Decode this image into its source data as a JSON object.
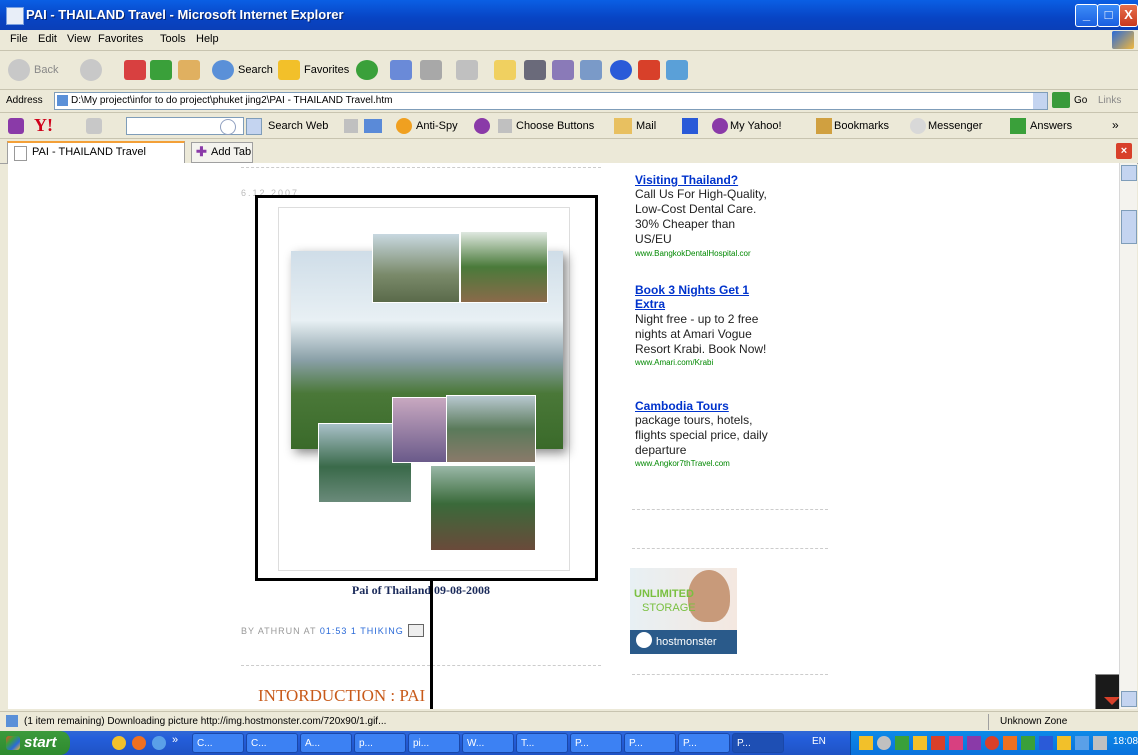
{
  "window": {
    "title": "PAI - THAILAND Travel - Microsoft Internet Explorer",
    "controls": [
      "_",
      "□",
      "X"
    ]
  },
  "menu": [
    "File",
    "Edit",
    "View",
    "Favorites",
    "Tools",
    "Help"
  ],
  "toolbar": {
    "back": "Back",
    "search": "Search",
    "favorites": "Favorites"
  },
  "address": {
    "label": "Address",
    "url": "D:\\My project\\infor to do project\\phuket jing2\\PAI - THAILAND Travel.htm",
    "go": "Go",
    "links": "Links"
  },
  "yahoo": {
    "search_web": "Search Web",
    "anti_spy": "Anti-Spy",
    "choose_buttons": "Choose Buttons",
    "mail": "Mail",
    "my_yahoo": "My Yahoo!",
    "bookmarks": "Bookmarks",
    "messenger": "Messenger",
    "answers": "Answers"
  },
  "tabs": {
    "active": "PAI - THAILAND Travel",
    "add": "Add Tab"
  },
  "post": {
    "date": "6.12.2007",
    "caption": "Pai of Thailand 09-08-2008",
    "by": "BY ATHRUN AT",
    "time": "01:53",
    "comments": "1 THIKING",
    "heading": "INTORDUCTION : PAI"
  },
  "ads": [
    {
      "title": "Visiting Thailand?",
      "body": "Call Us For High-Quality, Low-Cost Dental Care. 30% Cheaper than US/EU",
      "url": "www.BangkokDentalHospital.cor"
    },
    {
      "title": "Book 3 Nights Get 1 Extra",
      "body": "Night free - up to 2 free nights at Amari Vogue Resort Krabi. Book Now!",
      "url": "www.Amari.com/Krabi"
    },
    {
      "title": "Cambodia Tours",
      "body": "package tours, hotels, flights special price, daily departure",
      "url": "www.Angkor7thTravel.com"
    }
  ],
  "banner": {
    "line1": "UNLIMITED",
    "line2": "STORAGE",
    "brand": "hostmonster"
  },
  "status": {
    "text": "(1 item remaining) Downloading picture http://img.hostmonster.com/720x90/1.gif...",
    "zone": "Unknown Zone"
  },
  "taskbar": {
    "start": "start",
    "tasks": [
      "C...",
      "C...",
      "A...",
      "p...",
      "pi...",
      "W...",
      "T...",
      "P...",
      "P...",
      "P...",
      "P..."
    ],
    "lang": "EN",
    "clock": "18:08"
  }
}
